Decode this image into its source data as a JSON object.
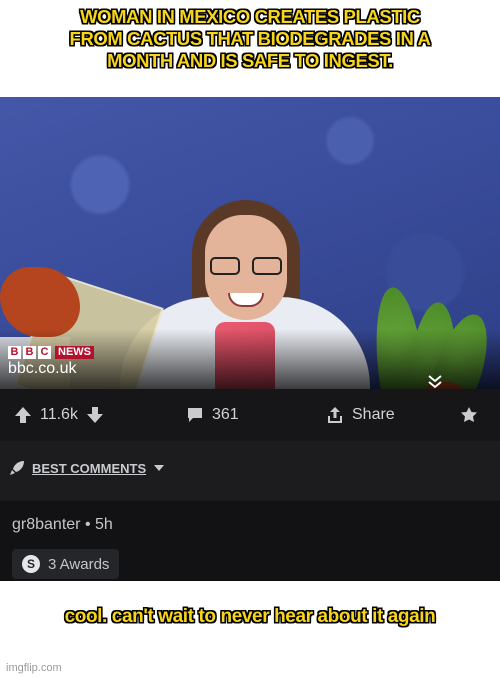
{
  "top_caption": [
    "WOMAN IN MEXICO CREATES PLASTIC",
    "FROM CACTUS THAT BIODEGRADES IN A",
    "MONTH AND IS SAFE TO INGEST."
  ],
  "video_overlay": {
    "logo_letters": [
      "B",
      "B",
      "C"
    ],
    "logo_news": "NEWS",
    "domain": "bbc.co.uk"
  },
  "actions": {
    "upvotes": "11.6k",
    "comments": "361",
    "share_label": "Share"
  },
  "comments_section": {
    "sort_label": "BEST COMMENTS"
  },
  "comment": {
    "author_meta": "gr8banter • 5h",
    "awards_label": "3 Awards",
    "awards_icon_letter": "S"
  },
  "bottom_caption": "cool. can't wait to never hear about it again",
  "watermark": "imgflip.com",
  "colors": {
    "caption_yellow": "#f7d51d",
    "dark_bar": "#161618",
    "bbc_red": "#b3122e"
  },
  "icons": [
    "upvote-icon",
    "downvote-icon",
    "comment-icon",
    "share-icon",
    "award-icon",
    "rocket-icon",
    "chevron-down-icon"
  ]
}
